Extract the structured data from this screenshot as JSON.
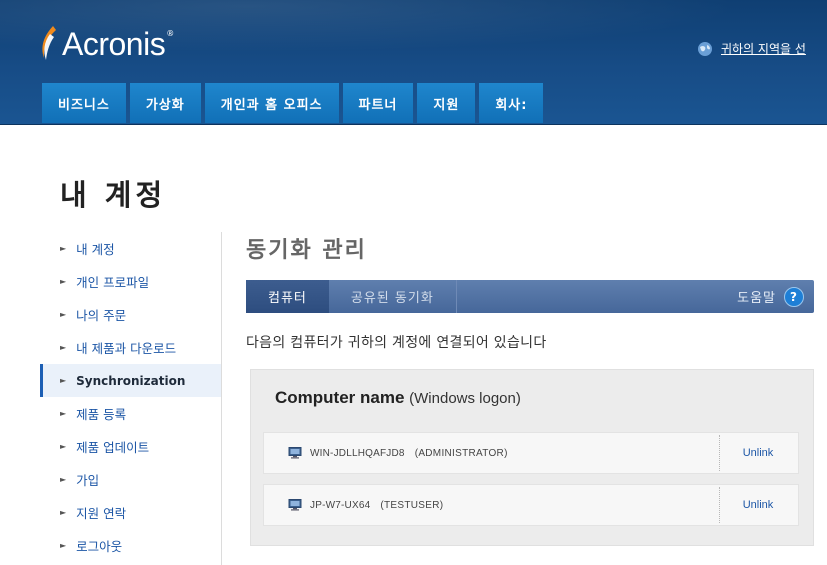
{
  "brand": {
    "logo_text": "Acronis",
    "logo_reg": "®",
    "colors": {
      "header": "#174c86",
      "nav_tab": "#1a7cc4",
      "link": "#1c56a6",
      "tabbar": "#5273a4"
    }
  },
  "region": {
    "icon": "globe-icon",
    "text": "귀하의 지역을 선"
  },
  "nav": {
    "items": [
      {
        "label": "비즈니스"
      },
      {
        "label": "가상화"
      },
      {
        "label": "개인과 홈 오피스"
      },
      {
        "label": "파트너"
      },
      {
        "label": "지원"
      },
      {
        "label": "회사:"
      }
    ]
  },
  "page": {
    "title": "내 계정"
  },
  "sidebar": {
    "items": [
      {
        "label": "내 계정"
      },
      {
        "label": "개인 프로파일"
      },
      {
        "label": "나의 주문"
      },
      {
        "label": "내 제품과 다운로드"
      },
      {
        "label": "Synchronization",
        "active": true
      },
      {
        "label": "제품 등록"
      },
      {
        "label": "제품 업데이트"
      },
      {
        "label": "가입"
      },
      {
        "label": "지원 연락"
      },
      {
        "label": "로그아웃"
      }
    ]
  },
  "main": {
    "title": "동기화 관리",
    "tabs": [
      {
        "label": "컴퓨터",
        "active": true
      },
      {
        "label": "공유된 동기화",
        "active": false
      }
    ],
    "help_label": "도움말",
    "help_icon": "?",
    "subtitle": "다음의 컴퓨터가 귀하의 계정에 연결되어 있습니다",
    "table": {
      "header_bold": "Computer name",
      "header_sub": "(Windows logon)",
      "rows": [
        {
          "name": "WIN-JDLLHQAFJD8",
          "user": "(ADMINISTRATOR)",
          "action": "Unlink"
        },
        {
          "name": "JP-W7-UX64",
          "user": "(TESTUSER)",
          "action": "Unlink"
        }
      ]
    }
  }
}
